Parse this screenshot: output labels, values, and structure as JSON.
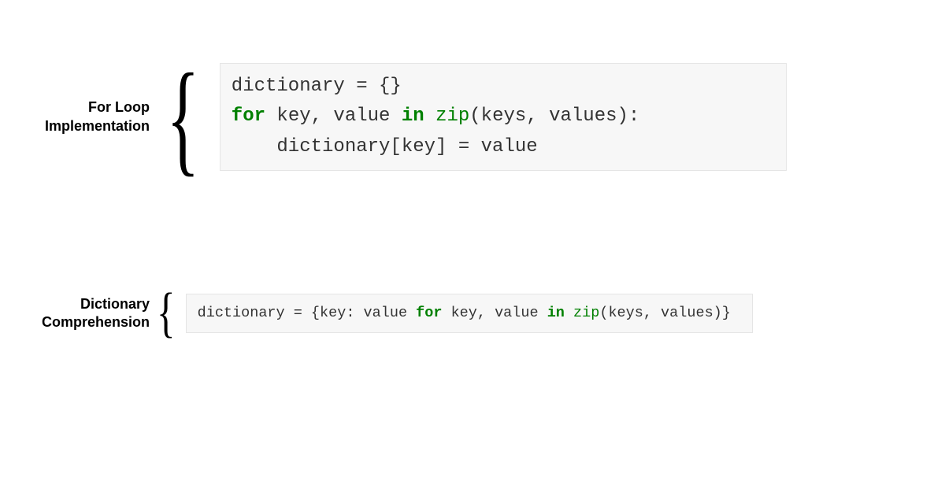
{
  "section1": {
    "label_line1": "For Loop",
    "label_line2": "Implementation",
    "code": {
      "l1_a": "dictionary = {}",
      "l2_kw1": "for",
      "l2_a": " key, value ",
      "l2_kw2": "in",
      "l2_b": " ",
      "l2_fn": "zip",
      "l2_c": "(keys, values):",
      "l3_a": "    dictionary[key] = value"
    }
  },
  "section2": {
    "label_line1": "Dictionary",
    "label_line2": "Comprehension",
    "code": {
      "a": "dictionary = {key: value ",
      "kw1": "for",
      "b": " key, value ",
      "kw2": "in",
      "c": " ",
      "fn": "zip",
      "d": "(keys, values)}"
    }
  }
}
